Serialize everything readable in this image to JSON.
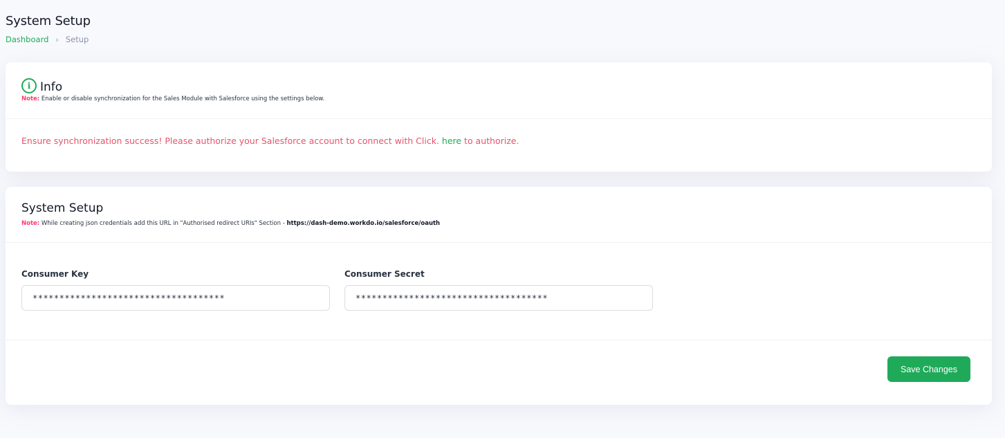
{
  "page": {
    "title": "System Setup",
    "breadcrumb": {
      "home": "Dashboard",
      "separator": "›",
      "current": "Setup"
    }
  },
  "info_card": {
    "icon": "info-icon",
    "icon_glyph": "i",
    "title": "Info",
    "note_label": "Note:",
    "note_text": " Enable or disable synchronization for the Sales Module with Salesforce using the settings below.",
    "auth_prefix": "Ensure synchronization success! Please authorize your Salesforce account to connect with Click. ",
    "auth_link": "here",
    "auth_suffix": " to authorize."
  },
  "setup_card": {
    "title": "System Setup",
    "note_label": "Note:",
    "note_text": " While creating json credentials add this URL in \"Authorised redirect URIs\" Section - ",
    "note_url": "https://dash-demo.workdo.io/salesforce/oauth",
    "fields": {
      "consumer_key": {
        "label": "Consumer Key",
        "value": "************************************"
      },
      "consumer_secret": {
        "label": "Consumer Secret",
        "value": "************************************"
      }
    },
    "save_label": "Save Changes"
  },
  "colors": {
    "accent": "#1faa59",
    "note": "#ff3a6e",
    "warning_text": "#e8536b",
    "background": "#f8f9fd"
  }
}
